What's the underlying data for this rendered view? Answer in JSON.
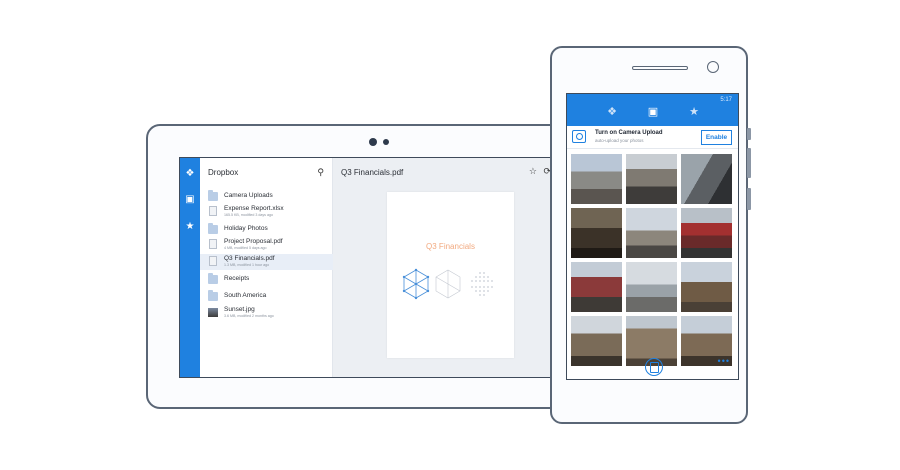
{
  "tablet": {
    "app_title": "Dropbox",
    "rail_icons": [
      "dropbox-icon",
      "photos-icon",
      "star-icon"
    ],
    "search_icon": "search-icon",
    "files": [
      {
        "name": "Camera Uploads",
        "type": "folder",
        "meta": ""
      },
      {
        "name": "Expense Report.xlsx",
        "type": "file",
        "meta": "165.5 KB, modified 3 days ago"
      },
      {
        "name": "Holiday Photos",
        "type": "folder",
        "meta": ""
      },
      {
        "name": "Project Proposal.pdf",
        "type": "file",
        "meta": "4 MB, modified 5 days ago"
      },
      {
        "name": "Q3 Financials.pdf",
        "type": "file",
        "meta": "1.3 MB, modified 1 hour ago",
        "selected": true
      },
      {
        "name": "Receipts",
        "type": "folder",
        "meta": ""
      },
      {
        "name": "South America",
        "type": "folder",
        "meta": ""
      },
      {
        "name": "Sunset.jpg",
        "type": "photo",
        "meta": "3.6 MB, modified 2 months ago"
      }
    ],
    "preview": {
      "title": "Q3 Financials.pdf",
      "page_title": "Q3 Financials",
      "actions": [
        "star-icon",
        "share-icon"
      ]
    }
  },
  "phone": {
    "clock": "5:17",
    "tabs": [
      "dropbox-icon",
      "photos-icon",
      "star-icon"
    ],
    "banner": {
      "title": "Turn on Camera Upload",
      "subtitle": "auto-upload your photos",
      "button": "Enable"
    },
    "photo_count": 12,
    "more": "•••"
  },
  "colors": {
    "accent": "#1f81e0",
    "device_outline": "#5a6676",
    "preview_title": "#f2a97f"
  }
}
